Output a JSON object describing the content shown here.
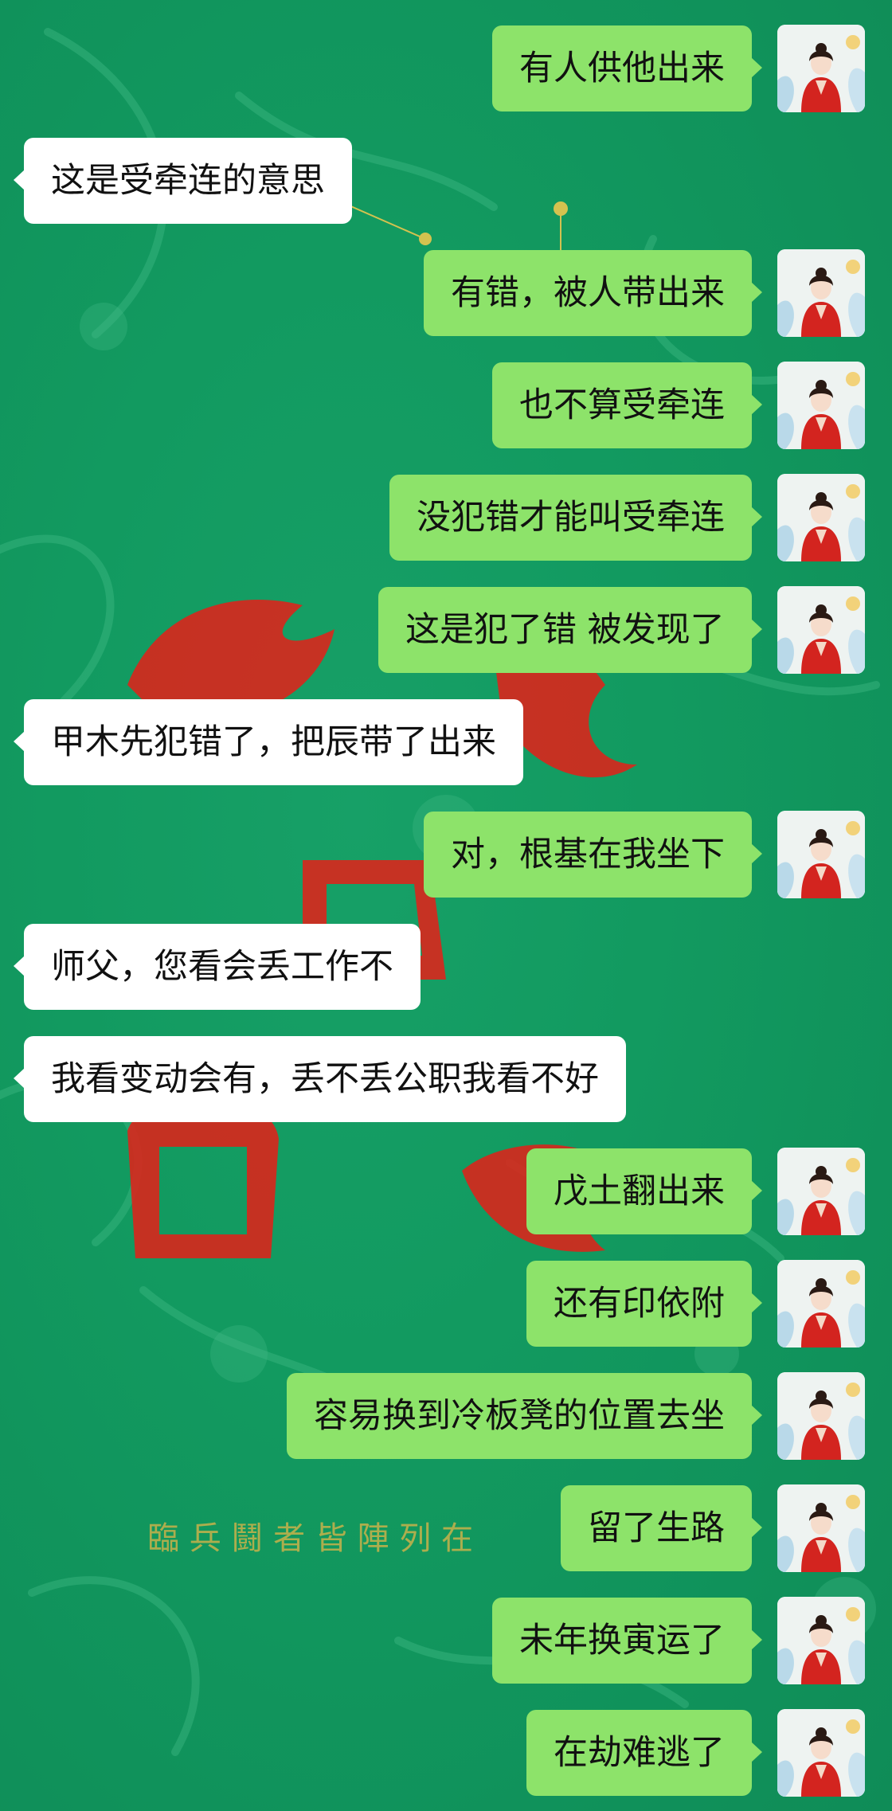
{
  "background": {
    "watermark_text": "臨 兵 鬪 者 皆 陣 列 在",
    "colors": {
      "base": "#129a60",
      "accent_red": "#d9261c",
      "gold": "#c8b24a"
    }
  },
  "colors": {
    "outgoing_bubble": "#8de36a",
    "incoming_bubble": "#ffffff"
  },
  "messages": [
    {
      "side": "me",
      "text": "有人供他出来"
    },
    {
      "side": "them",
      "text": "这是受牵连的意思"
    },
    {
      "side": "me",
      "text": "有错，被人带出来"
    },
    {
      "side": "me",
      "text": "也不算受牵连"
    },
    {
      "side": "me",
      "text": "没犯错才能叫受牵连"
    },
    {
      "side": "me",
      "text": "这是犯了错 被发现了"
    },
    {
      "side": "them",
      "text": "甲木先犯错了，把辰带了出来"
    },
    {
      "side": "me",
      "text": "对，根基在我坐下"
    },
    {
      "side": "them",
      "text": "师父，您看会丢工作不"
    },
    {
      "side": "them",
      "text": "我看变动会有，丢不丢公职我看不好"
    },
    {
      "side": "me",
      "text": "戊土翻出来"
    },
    {
      "side": "me",
      "text": "还有印依附"
    },
    {
      "side": "me",
      "text": "容易换到冷板凳的位置去坐"
    },
    {
      "side": "me",
      "text": "留了生路"
    },
    {
      "side": "me",
      "text": "未年换寅运了"
    },
    {
      "side": "me",
      "text": "在劫难逃了"
    }
  ]
}
